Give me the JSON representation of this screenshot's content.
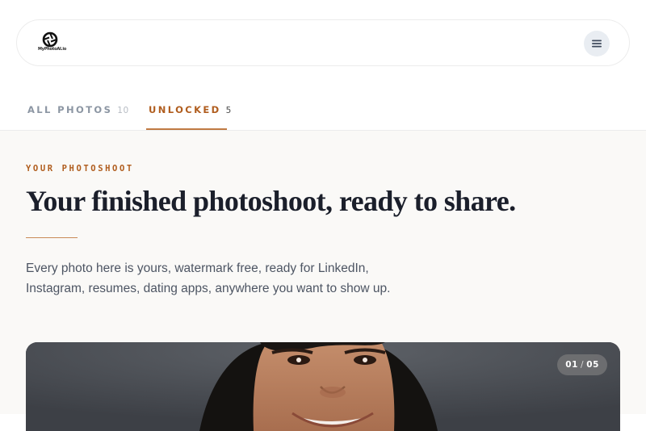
{
  "header": {
    "logo_text": "MyPhotoAI.io",
    "menu_icon": "hamburger-menu-icon"
  },
  "tabs": [
    {
      "label": "ALL PHOTOS",
      "count": "10"
    },
    {
      "label": "UNLOCKED",
      "count": "5"
    }
  ],
  "main": {
    "eyebrow": "YOUR PHOTOSHOOT",
    "headline": "Your finished photoshoot, ready to share.",
    "description_line1": "Every photo here is yours, watermark free, ready for LinkedIn,",
    "description_line2": "Instagram, resumes, dating apps, anywhere you want to show up."
  },
  "photo": {
    "current": "01",
    "separator": "/",
    "total": "05"
  },
  "colors": {
    "accent": "#b05d1e",
    "headline": "#1b1f2b",
    "page_bg": "#faf9f7"
  }
}
